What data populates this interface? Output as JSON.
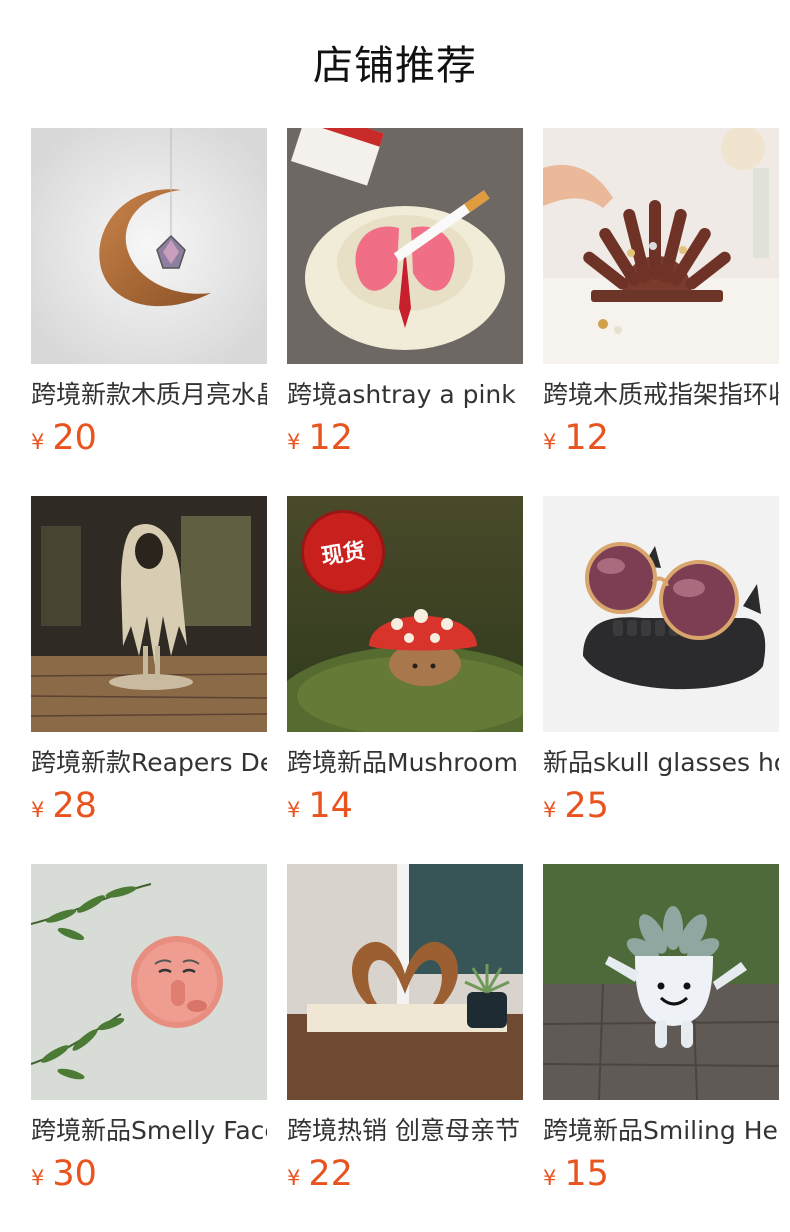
{
  "section": {
    "title": "店铺推荐"
  },
  "colors": {
    "price": "#e8531e",
    "title": "#111111",
    "name": "#333333"
  },
  "products": [
    {
      "name": "跨境新款木质月亮水晶",
      "currency": "¥",
      "price": "20",
      "image_icon": "moon-suncatcher-image"
    },
    {
      "name": "跨境ashtray a pink lung",
      "currency": "¥",
      "price": "12",
      "image_icon": "lung-ashtray-image"
    },
    {
      "name": "跨境木质戒指架指环收纳",
      "currency": "¥",
      "price": "12",
      "image_icon": "ring-holder-image"
    },
    {
      "name": "跨境新款Reapers Decor",
      "currency": "¥",
      "price": "28",
      "image_icon": "reaper-statue-image"
    },
    {
      "name": "跨境新品Mushroom",
      "currency": "¥",
      "price": "14",
      "image_icon": "mushroom-figure-image",
      "badge": "现货"
    },
    {
      "name": "新品skull glasses holder",
      "currency": "¥",
      "price": "25",
      "image_icon": "skull-glasses-holder-image"
    },
    {
      "name": "跨境新品Smelly Face",
      "currency": "¥",
      "price": "30",
      "image_icon": "smelly-face-plaque-image"
    },
    {
      "name": "跨境热销 创意母亲节",
      "currency": "¥",
      "price": "22",
      "image_icon": "heart-hands-sculpture-image"
    },
    {
      "name": "跨境新品Smiling Head",
      "currency": "¥",
      "price": "15",
      "image_icon": "smiling-planter-image"
    }
  ]
}
